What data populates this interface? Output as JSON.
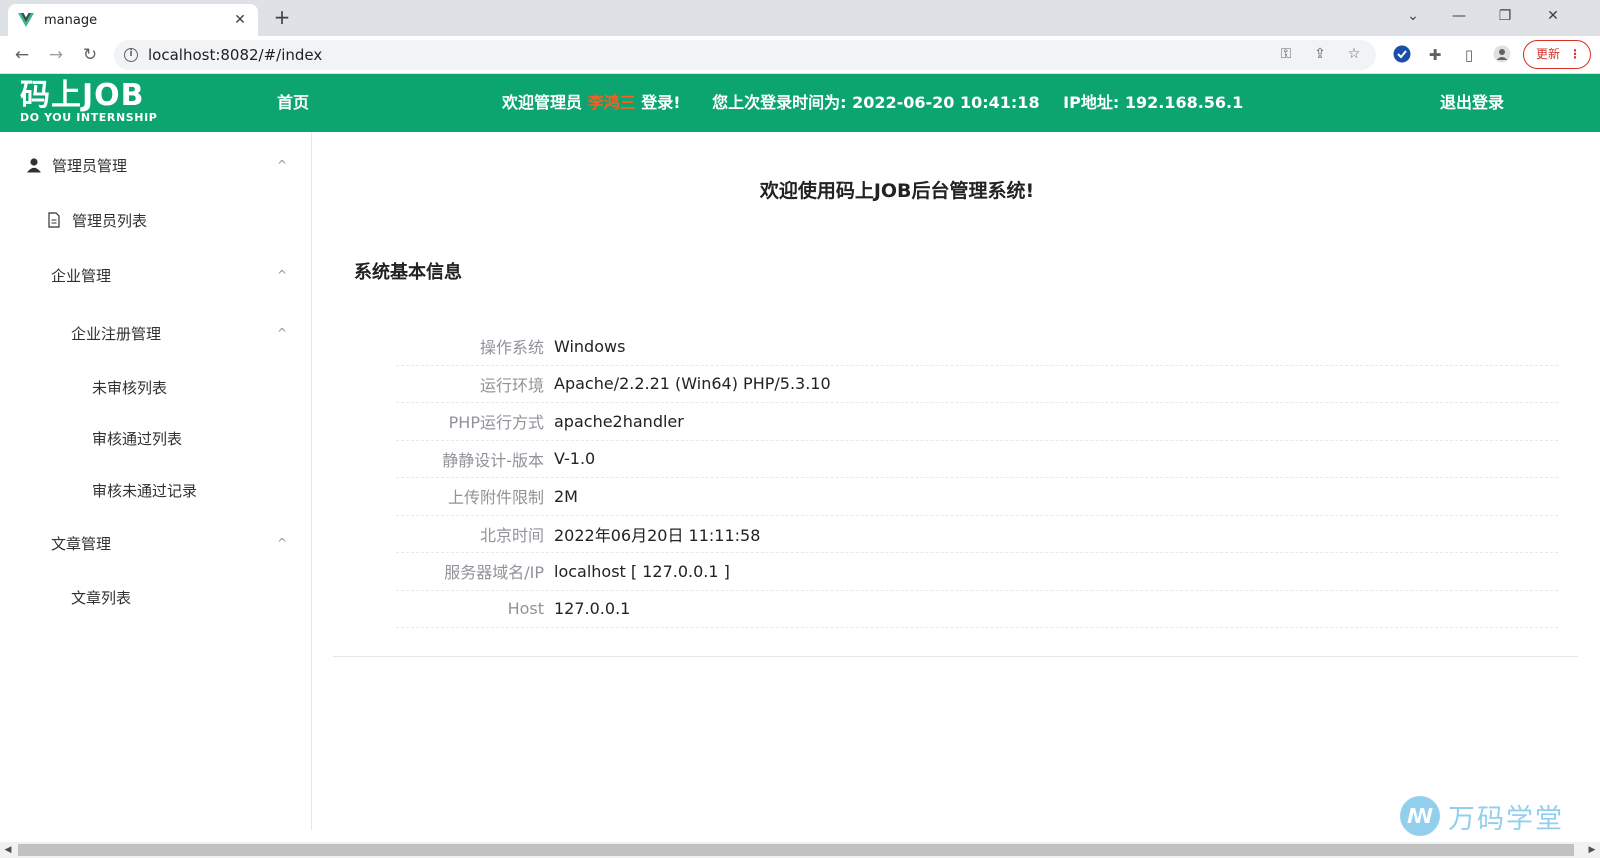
{
  "browser": {
    "tab_title": "manage",
    "tab_close": "✕",
    "new_tab": "+",
    "url": "localhost:8082/#/index",
    "update_label": "更新",
    "update_menu": "⋮"
  },
  "header": {
    "logo_main": "码上JOB",
    "logo_sub": "DO YOU INTERNSHIP",
    "nav_home": "首页",
    "welcome_prefix": "欢迎管理员",
    "welcome_user": "李鸿三",
    "welcome_suffix": "登录!",
    "last_login_label": "您上次登录时间为:",
    "last_login_time": "2022-06-20 10:41:18",
    "ip_label": "IP地址:",
    "ip_value": "192.168.56.1",
    "logout": "退出登录"
  },
  "sidebar": {
    "items": [
      {
        "label": "管理员管理",
        "arrow": "^"
      },
      {
        "label": "管理员列表"
      },
      {
        "label": "企业管理",
        "arrow": "^"
      },
      {
        "label": "企业注册管理",
        "arrow": "^"
      },
      {
        "label": "未审核列表"
      },
      {
        "label": "审核通过列表"
      },
      {
        "label": "审核未通过记录"
      },
      {
        "label": "文章管理",
        "arrow": "^"
      },
      {
        "label": "文章列表"
      }
    ]
  },
  "main": {
    "welcome_title": "欢迎使用码上JOB后台管理系统!",
    "section_title": "系统基本信息",
    "info": [
      {
        "label": "操作系统",
        "value": "Windows"
      },
      {
        "label": "运行环境",
        "value": "Apache/2.2.21 (Win64) PHP/5.3.10"
      },
      {
        "label": "PHP运行方式",
        "value": "apache2handler"
      },
      {
        "label": "静静设计-版本",
        "value": "V-1.0"
      },
      {
        "label": "上传附件限制",
        "value": "2M"
      },
      {
        "label": "北京时间",
        "value": "2022年06月20日 11:11:58"
      },
      {
        "label": "服务器域名/IP",
        "value": "localhost [ 127.0.0.1 ]"
      },
      {
        "label": "Host",
        "value": "127.0.0.1"
      }
    ]
  },
  "watermark": {
    "text": "万码学堂"
  },
  "colors": {
    "header_bg": "#0ca46f",
    "username": "#ff5a1f"
  }
}
